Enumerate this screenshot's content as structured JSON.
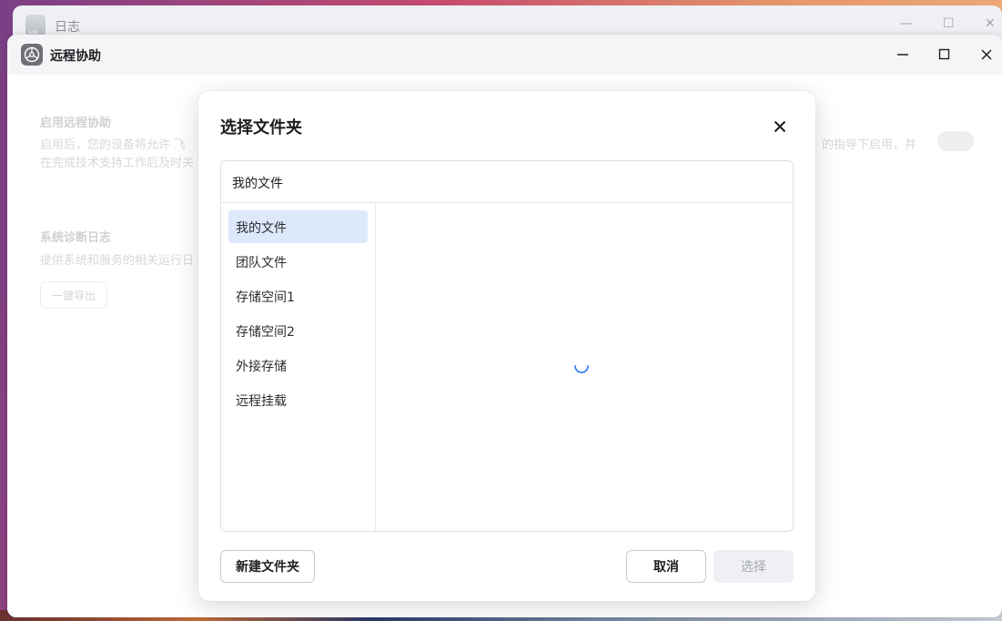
{
  "background_window": {
    "title": "日志",
    "icon_label": "Log"
  },
  "window": {
    "title": "远程协助",
    "controls": [
      "minimize",
      "maximize",
      "close"
    ]
  },
  "page": {
    "remote": {
      "title": "启用远程协助",
      "desc_line1": "启用后，您的设备将允许 飞",
      "desc_line1_right": "的指导下启用，并",
      "desc_line2": "在完成技术支持工作后及时关"
    },
    "logs": {
      "title": "系统诊断日志",
      "desc": "提供系统和服务的相关运行日",
      "export_label": "一键导出"
    }
  },
  "dialog": {
    "title": "选择文件夹",
    "path": "我的文件",
    "sidebar": [
      {
        "label": "我的文件",
        "active": true
      },
      {
        "label": "团队文件",
        "active": false
      },
      {
        "label": "存储空间1",
        "active": false
      },
      {
        "label": "存储空间2",
        "active": false
      },
      {
        "label": "外接存储",
        "active": false
      },
      {
        "label": "远程挂载",
        "active": false
      }
    ],
    "new_folder_label": "新建文件夹",
    "cancel_label": "取消",
    "select_label": "选择"
  },
  "colors": {
    "accent": "#3b7ff0",
    "active_item_bg": "#dde8fb"
  }
}
